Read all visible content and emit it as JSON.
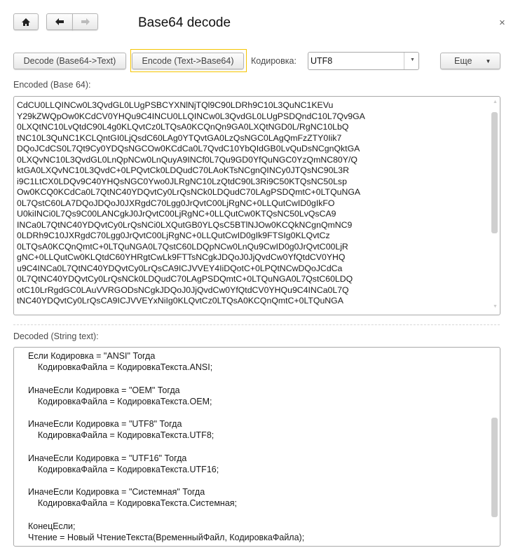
{
  "header": {
    "title": "Base64 decode",
    "home_icon": "home-icon",
    "back_icon": "arrow-left-icon",
    "forward_icon": "arrow-right-icon",
    "close": "×"
  },
  "toolbar": {
    "decode_label": "Decode (Base64->Text)",
    "encode_label": "Encode (Text->Base64)",
    "encoding_label": "Кодировка:",
    "encoding_value": "UTF8",
    "more_label": "Еще",
    "focus_color": "#f5c400"
  },
  "encoded": {
    "label": "Encoded (Base 64):",
    "lines": [
      "CdCU0LLQINCw0L3QvdGL0LUgPSBCYXNlNjTQl9C90LDRh9C10L3QuNC1KEVu",
      "Y29kZWQpOw0KCdCV0YHQu9C4INCU0LLQINCw0L3QvdGL0LUgPSDQndC10L7Qv9GA",
      "0LXQtNC10LvQtdC90L4g0KLQvtCz0LTQsA0KCQnQn9GA0LXQtNGD0L/RgNC10LbQ",
      "tNC10L3QuNC1KCLQntGI0LjQsdC60LAg0YTQvtGA0LzQsNGC0LAgQmFzZTY0Iik7",
      "DQoJCdCS0L7Qt9Cy0YDQsNGCOw0KCdCa0L7QvdC10YbQIdGB0LvQuDsNCgnQktGA",
      "0LXQvNC10L3QvdGL0LnQpNCw0LnQuyA9INCf0L7Qu9GD0YfQuNGC0YzQmNC80Y/Q",
      "ktGA0LXQvNC10L3QvdC+0LPQvtCk0LDQudC70LAoKTsNCgnQINCy0JTQsNC90L3R",
      "i9C1LtCX0LDQv9C40YHQsNGC0Ywo0JLRgNC10LzQtdC90L3Ri9C50KTQsNC50Lsp",
      "Ow0KCQ0KCdCa0L7QtNC40YDQvtCy0LrQsNCk0LDQudC70LAgPSDQmtC+0LTQuNGA",
      "0L7QstC60LA7DQoJDQoJ0JXRgdC70Lgg0JrQvtC00LjRgNC+0LLQutCwID0gIkFO",
      "U0kiINCi0L7Qs9C00LANCgkJ0JrQvtC00LjRgNC+0LLQutCw0KTQsNC50LvQsCA9",
      "INCa0L7QtNC40YDQvtCy0LrQsNCi0LXQutGB0YLQsC5BTlNJOw0KCQkNCgnQmNC9",
      "0LDRh9C10JXRgdC70Lgg0JrQvtC00LjRgNC+0LLQutCwID0gIk9FTSIg0KLQvtCz",
      "0LTQsA0KCQnQmtC+0LTQuNGA0L7QstC60LDQpNCw0LnQu9CwID0g0JrQvtC00LjR",
      "gNC+0LLQutCw0KLQtdC60YHRgtCwLk9FTTsNCgkJDQoJ0JjQvdCw0YfQtdCV0YHQ",
      "u9C4INCa0L7QtNC40YDQvtCy0LrQsCA9ICJVVEY4IiDQotC+0LPQtNCwDQoJCdCa",
      "0L7QtNC40YDQvtCy0LrQsNCk0LDQudC70LAgPSDQmtC+0LTQuNGA0L7QstC60LDQ",
      "otC10LrRgdGC0LAuVVRGODsNCgkJDQoJ0JjQvdCw0YfQtdCV0YHQu9C4INCa0L7Q",
      "tNC40YDQvtCy0LrQsCA9ICJVVEYxNiIg0KLQvtCz0LTQsA0KCQnQmtC+0LTQuNGA"
    ],
    "scroll_position": 0
  },
  "decoded": {
    "label": "Decoded (String text):",
    "lines": [
      "Если Кодировка = \"ANSI\" Тогда",
      "    КодировкаФайла = КодировкаТекста.ANSI;",
      "",
      "ИначеЕсли Кодировка = \"OEM\" Тогда",
      "    КодировкаФайла = КодировкаТекста.OEM;",
      "",
      "ИначеЕсли Кодировка = \"UTF8\" Тогда",
      "    КодировкаФайла = КодировкаТекста.UTF8;",
      "",
      "ИначеЕсли Кодировка = \"UTF16\" Тогда",
      "    КодировкаФайла = КодировкаТекста.UTF16;",
      "",
      "ИначеЕсли Кодировка = \"Системная\" Тогда",
      "    КодировкаФайла = КодировкаТекста.Системная;",
      "",
      "КонецЕсли;",
      "Чтение = Новый ЧтениеТекста(ВременныйФайл, КодировкаФайла);"
    ]
  }
}
